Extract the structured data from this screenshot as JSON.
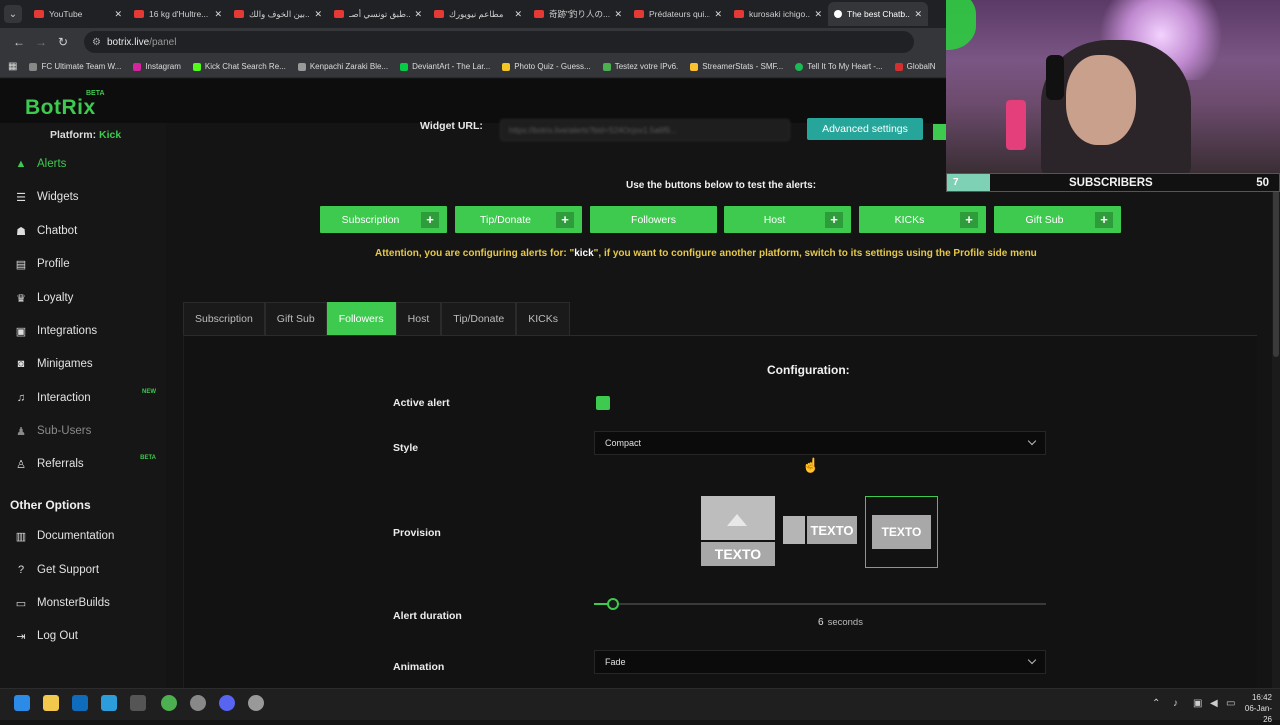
{
  "browser": {
    "tabs": [
      {
        "title": "YouTube"
      },
      {
        "title": "16 kg d'Hultre..."
      },
      {
        "title": "بين الخوف والك..."
      },
      {
        "title": "طبق تونسي أصـ..."
      },
      {
        "title": "مطاعم نيويورك"
      },
      {
        "title": "奇跡\"釣り人の..."
      },
      {
        "title": "Prédateurs qui..."
      },
      {
        "title": "kurosaki ichigo..."
      },
      {
        "title": "The best Chatb..."
      }
    ],
    "url_host": "botrix.live",
    "url_path": "/panel",
    "bookmarks": [
      "FC Ultimate Team W...",
      "Instagram",
      "Kick Chat Search Re...",
      "Kenpachi Zaraki Ble...",
      "DeviantArt - The Lar...",
      "Photo Quiz - Guess...",
      "Testez votre IPv6.",
      "StreamerStats - SMF...",
      "Tell It To My Heart -...",
      "GlobalN"
    ]
  },
  "app": {
    "logo": "BotRix",
    "logo_badge": "BETA",
    "platform_label": "Platform:",
    "platform_value": "Kick"
  },
  "sidebar": {
    "items": [
      {
        "label": "Alerts",
        "icon": "warning-icon"
      },
      {
        "label": "Widgets",
        "icon": "list-icon"
      },
      {
        "label": "Chatbot",
        "icon": "robot-icon"
      },
      {
        "label": "Profile",
        "icon": "id-card-icon"
      },
      {
        "label": "Loyalty",
        "icon": "trophy-icon"
      },
      {
        "label": "Integrations",
        "icon": "puzzle-icon"
      },
      {
        "label": "Minigames",
        "icon": "gamepad-icon"
      },
      {
        "label": "Interaction",
        "icon": "music-icon",
        "badge": "NEW"
      },
      {
        "label": "Sub-Users",
        "icon": "users-icon"
      },
      {
        "label": "Referrals",
        "icon": "user-plus-icon",
        "badge": "BETA"
      }
    ],
    "other_title": "Other Options",
    "other_items": [
      {
        "label": "Documentation",
        "icon": "book-icon"
      },
      {
        "label": "Get Support",
        "icon": "help-icon"
      },
      {
        "label": "MonsterBuilds",
        "icon": "monitor-icon"
      },
      {
        "label": "Log Out",
        "icon": "logout-icon"
      }
    ]
  },
  "widget": {
    "label": "Widget URL:",
    "url": "https://botrix.live/alerts?bid=S24Ocjox1.5a6f9...",
    "advanced": "Advanced settings"
  },
  "test": {
    "title": "Use the buttons below to test the alerts:",
    "buttons": [
      "Subscription",
      "Tip/Donate",
      "Followers",
      "Host",
      "KICKs",
      "Gift Sub"
    ]
  },
  "attention": {
    "prefix": "Attention, you are configuring alerts for: \"",
    "platform": "kick",
    "suffix": "\", if you want to configure another platform, switch to its settings using the Profile side menu"
  },
  "alert_tabs": [
    "Subscription",
    "Gift Sub",
    "Followers",
    "Host",
    "Tip/Donate",
    "KICKs"
  ],
  "active_tab": "Followers",
  "config": {
    "title": "Configuration:",
    "active_alert_label": "Active alert",
    "active_alert": true,
    "style_label": "Style",
    "style_value": "Compact",
    "provision_label": "Provision",
    "provision_text": "TEXTO",
    "duration_label": "Alert duration",
    "duration_value": "6",
    "duration_unit": "seconds",
    "animation_label": "Animation",
    "animation_value": "Fade"
  },
  "overlay": {
    "sub_count": "7",
    "label": "SUBSCRIBERS",
    "goal": "50"
  },
  "taskbar": {
    "time": "16:42",
    "date": "06-Jan-26"
  },
  "colors": {
    "accent": "#3ec94f",
    "teal": "#26a69a",
    "warning": "#e6c84a"
  }
}
